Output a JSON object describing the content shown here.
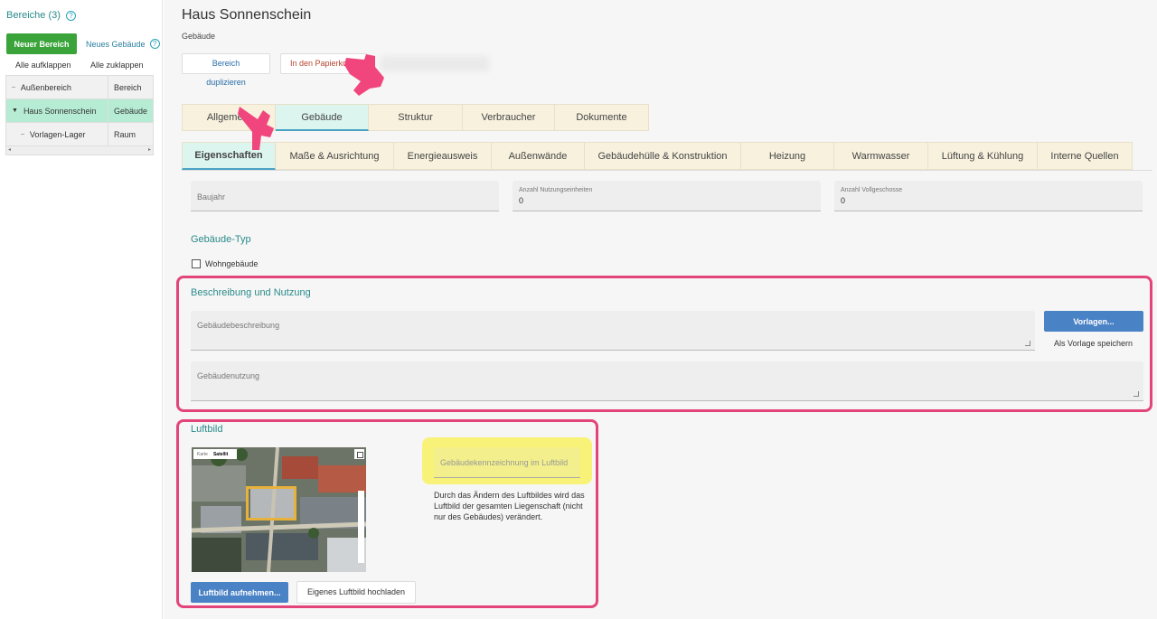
{
  "sidebar": {
    "title": "Bereiche (3)",
    "help_icon": "question-circle-icon",
    "new_area_button": "Neuer Bereich",
    "new_building_link": "Neues Gebäude",
    "expand_all": "Alle aufklappen",
    "collapse_all": "Alle zuklappen",
    "tree": [
      {
        "name": "Außenbereich",
        "type": "Bereich",
        "selected": false,
        "indent": 0
      },
      {
        "name": "Haus Sonnenschein",
        "type": "Gebäude",
        "selected": true,
        "indent": 0
      },
      {
        "name": "Vorlagen-Lager",
        "type": "Raum",
        "selected": false,
        "indent": 1
      }
    ]
  },
  "header": {
    "title": "Haus Sonnenschein",
    "subtitle": "Gebäude",
    "duplicate_button": "Bereich duplizieren",
    "trash_button": "In den Papierkorb"
  },
  "tabs_main": [
    {
      "label": "Allgemein",
      "active": false
    },
    {
      "label": "Gebäude",
      "active": true
    },
    {
      "label": "Struktur",
      "active": false
    },
    {
      "label": "Verbraucher",
      "active": false
    },
    {
      "label": "Dokumente",
      "active": false
    }
  ],
  "tabs_sub": [
    {
      "label": "Eigenschaften",
      "active": true
    },
    {
      "label": "Maße & Ausrichtung",
      "active": false
    },
    {
      "label": "Energieausweis",
      "active": false
    },
    {
      "label": "Außenwände",
      "active": false
    },
    {
      "label": "Gebäudehülle & Konstruktion",
      "active": false
    },
    {
      "label": "Heizung",
      "active": false
    },
    {
      "label": "Warmwasser",
      "active": false
    },
    {
      "label": "Lüftung & Kühlung",
      "active": false
    },
    {
      "label": "Interne Quellen",
      "active": false
    }
  ],
  "fields": {
    "baujahr": {
      "label": "Baujahr",
      "value": ""
    },
    "nutzungseinheiten": {
      "label": "Anzahl Nutzungseinheiten",
      "value": "0"
    },
    "vollgeschosse": {
      "label": "Anzahl Vollgeschosse",
      "value": "0"
    }
  },
  "gebaeude_typ": {
    "heading": "Gebäude-Typ",
    "checkbox_label": "Wohngebäude",
    "checked": false
  },
  "beschreibung": {
    "heading": "Beschreibung und Nutzung",
    "description_label": "Gebäudebeschreibung",
    "usage_label": "Gebäudenutzung",
    "templates_button": "Vorlagen...",
    "save_template": "Als Vorlage speichern"
  },
  "luftbild": {
    "heading": "Luftbild",
    "map_tab_karte": "Karte",
    "map_tab_satellit": "Satellit",
    "marking_placeholder": "Gebäudekennzeichnung im Luftbild",
    "info_text": "Durch das Ändern des Luftbildes wird das Luftbild der gesamten Liegenschaft (nicht nur des Gebäudes) verändert.",
    "capture_button": "Luftbild aufnehmen...",
    "upload_button": "Eigenes Luftbild hochladen"
  },
  "colors": {
    "accent_teal": "#2a8a8a",
    "green_button": "#3aa43a",
    "blue_button": "#4a82c6",
    "highlight_pink": "#e3457a",
    "highlight_yellow": "#f8f378",
    "tab_bg": "#f7f1de",
    "tab_active": "#dcf5ee"
  }
}
